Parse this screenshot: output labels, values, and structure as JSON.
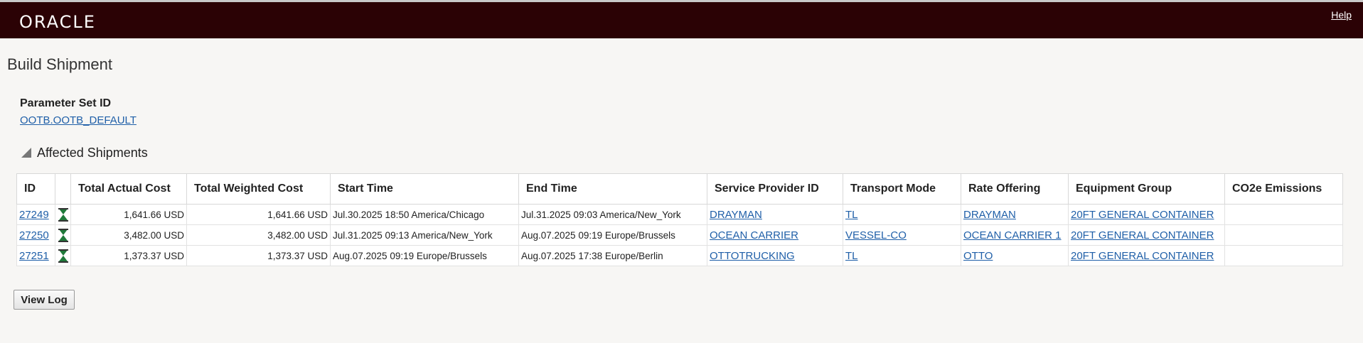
{
  "header": {
    "logo": "ORACLE",
    "help": "Help"
  },
  "page_title": "Build Shipment",
  "parameter": {
    "label": "Parameter Set ID",
    "value": "OOTB.OOTB_DEFAULT"
  },
  "section": {
    "title": "Affected Shipments"
  },
  "table": {
    "columns": [
      "ID",
      "",
      "Total Actual Cost",
      "Total Weighted Cost",
      "Start Time",
      "End Time",
      "Service Provider ID",
      "Transport Mode",
      "Rate Offering",
      "Equipment Group",
      "CO2e Emissions"
    ],
    "rows": [
      {
        "id": "27249",
        "icon": "hourglass-icon",
        "actual": "1,641.66 USD",
        "weighted": "1,641.66 USD",
        "start": "Jul.30.2025 18:50 America/Chicago",
        "end": "Jul.31.2025 09:03 America/New_York",
        "provider": "DRAYMAN",
        "mode": "TL",
        "rate": "DRAYMAN",
        "equipment": "20FT GENERAL CONTAINER",
        "co2": ""
      },
      {
        "id": "27250",
        "icon": "hourglass-icon",
        "actual": "3,482.00 USD",
        "weighted": "3,482.00 USD",
        "start": "Jul.31.2025 09:13 America/New_York",
        "end": "Aug.07.2025 09:19 Europe/Brussels",
        "provider": "OCEAN CARRIER",
        "mode": "VESSEL-CO",
        "rate": "OCEAN CARRIER 1",
        "equipment": "20FT GENERAL CONTAINER",
        "co2": ""
      },
      {
        "id": "27251",
        "icon": "hourglass-icon",
        "actual": "1,373.37 USD",
        "weighted": "1,373.37 USD",
        "start": "Aug.07.2025 09:19 Europe/Brussels",
        "end": "Aug.07.2025 17:38 Europe/Berlin",
        "provider": "OTTOTRUCKING",
        "mode": "TL",
        "rate": "OTTO",
        "equipment": "20FT GENERAL CONTAINER",
        "co2": ""
      }
    ]
  },
  "buttons": {
    "view_log": "View Log"
  }
}
